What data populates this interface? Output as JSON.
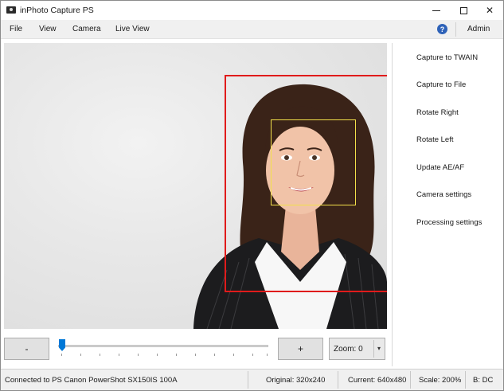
{
  "window": {
    "title": "inPhoto Capture PS"
  },
  "menu": {
    "items": [
      "File",
      "View",
      "Camera",
      "Live View"
    ],
    "help_symbol": "?",
    "admin": "Admin"
  },
  "actions": [
    "Capture to TWAIN",
    "Capture to File",
    "Rotate Right",
    "Rotate Left",
    "Update AE/AF",
    "Camera settings",
    "Processing settings"
  ],
  "zoom": {
    "minus_label": "-",
    "plus_label": "+",
    "select_value": "Zoom: 0",
    "slider_value": 0
  },
  "status": {
    "connection": "Connected to PS Canon PowerShot SX150IS 100A",
    "original": "Original: 320x240",
    "current": "Current: 640x480",
    "scale": "Scale: 200%",
    "extra": "B: DC"
  },
  "colors": {
    "face_box_outer": "#e01b1b",
    "face_box_inner": "#f2e04a",
    "slider_thumb": "#0078d7",
    "help_icon": "#2e62b8"
  }
}
